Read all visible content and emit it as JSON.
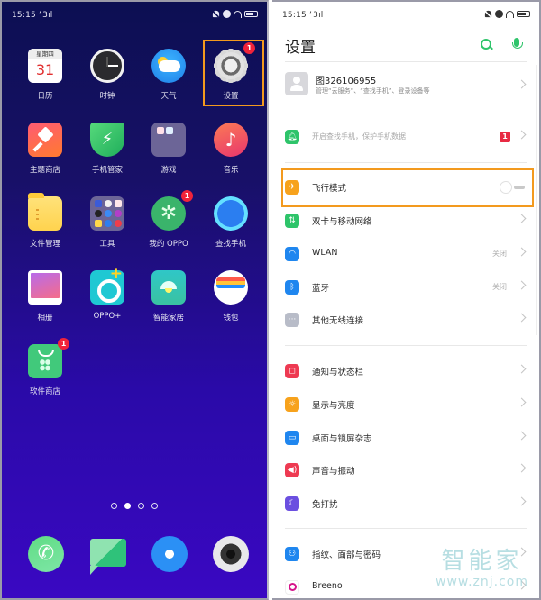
{
  "home": {
    "status_bar": {
      "time": "15:15",
      "signal": "’ 3ıl",
      "icons": [
        "mute-icon",
        "alarm-icon",
        "headphones-icon",
        "battery-icon"
      ]
    },
    "apps": [
      {
        "label": "日历",
        "icon": "calendar-icon",
        "weekday": "星期四",
        "day": "31"
      },
      {
        "label": "时钟",
        "icon": "clock-icon"
      },
      {
        "label": "天气",
        "icon": "weather-icon"
      },
      {
        "label": "设置",
        "icon": "settings-gear-icon",
        "badge": "1",
        "highlighted": true
      },
      {
        "label": "主题商店",
        "icon": "theme-store-icon"
      },
      {
        "label": "手机管家",
        "icon": "phone-manager-icon"
      },
      {
        "label": "游戏",
        "icon": "games-folder-icon"
      },
      {
        "label": "音乐",
        "icon": "music-icon"
      },
      {
        "label": "文件管理",
        "icon": "file-manager-icon"
      },
      {
        "label": "工具",
        "icon": "tools-folder-icon"
      },
      {
        "label": "我的 OPPO",
        "icon": "my-oppo-icon",
        "badge": "1"
      },
      {
        "label": "查找手机",
        "icon": "find-phone-icon"
      },
      {
        "label": "相册",
        "icon": "photos-icon"
      },
      {
        "label": "OPPO+",
        "icon": "oppo-plus-icon"
      },
      {
        "label": "智能家居",
        "icon": "smart-home-icon"
      },
      {
        "label": "钱包",
        "icon": "wallet-icon"
      },
      {
        "label": "软件商店",
        "icon": "app-store-icon",
        "badge": "1"
      }
    ],
    "page_indicator": {
      "count": 4,
      "active_index": 1
    },
    "dock": [
      {
        "name": "phone",
        "icon": "phone-icon"
      },
      {
        "name": "messages",
        "icon": "messages-icon"
      },
      {
        "name": "browser",
        "icon": "browser-icon"
      },
      {
        "name": "camera",
        "icon": "camera-icon"
      }
    ]
  },
  "settings": {
    "status_bar": {
      "time": "15:15",
      "signal": "’ 3ıl"
    },
    "title": "设置",
    "toolbar": {
      "search_icon": "search-icon",
      "voice_icon": "microphone-icon"
    },
    "account": {
      "name": "图326106955",
      "subtitle": "管理“云服务”、“查找手机”、登录设备等"
    },
    "notice": {
      "text": "开启查找手机，保护手机数据",
      "badge": "1",
      "icon": "bell-icon",
      "color": "#2ec46a"
    },
    "groups": [
      [
        {
          "label": "飞行模式",
          "icon": "airplane-icon",
          "color": "#f7a21c",
          "toggle": false,
          "highlighted": true
        },
        {
          "label": "双卡与移动网络",
          "icon": "sim-data-icon",
          "color": "#2ec46a"
        },
        {
          "label": "WLAN",
          "icon": "wifi-icon",
          "color": "#1f86ef",
          "value": "关闭"
        },
        {
          "label": "蓝牙",
          "icon": "bluetooth-icon",
          "color": "#1f86ef",
          "value": "关闭"
        },
        {
          "label": "其他无线连接",
          "icon": "more-connections-icon",
          "color": "#b8bcc8"
        }
      ],
      [
        {
          "label": "通知与状态栏",
          "icon": "notification-icon",
          "color": "#ee3a52"
        },
        {
          "label": "显示与亮度",
          "icon": "brightness-icon",
          "color": "#f7a21c"
        },
        {
          "label": "桌面与锁屏杂志",
          "icon": "wallpaper-icon",
          "color": "#1f86ef"
        },
        {
          "label": "声音与振动",
          "icon": "sound-icon",
          "color": "#ee3a52"
        },
        {
          "label": "免打扰",
          "icon": "do-not-disturb-icon",
          "color": "#6b4fe0"
        }
      ],
      [
        {
          "label": "指纹、面部与密码",
          "icon": "fingerprint-face-icon",
          "color": "#1f86ef"
        },
        {
          "label": "Breeno",
          "icon": "breeno-icon",
          "color": "#d5148a"
        }
      ]
    ],
    "watermark": {
      "text": "智能家",
      "url": "www.znj.com"
    }
  },
  "colors": {
    "highlight": "#f39a1e",
    "accent_green": "#2ec46a",
    "badge_red": "#f0233a"
  }
}
